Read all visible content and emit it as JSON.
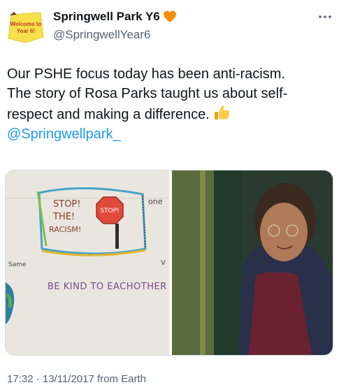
{
  "tweet": {
    "avatar_text": "Welcome to Year 6!",
    "display_name": "Springwell Park Y6",
    "handle": "@SpringwellYear6",
    "text_lines": [
      "Our PSHE focus today has been anti-racism.",
      "The story of Rosa Parks taught us about self-",
      "respect and making a difference."
    ],
    "mention": "@Springwellpark_",
    "timestamp": "17:32 · 13/11/2017 from Earth"
  },
  "media": {
    "drawing": {
      "caption_line1": "STOP!",
      "caption_line2": "THE!",
      "caption_line3": "RACISM!",
      "sign_text": "STOP!",
      "corner_right": "one",
      "left_label": "Same",
      "right_label": "V",
      "bottom_text": "BE KIND TO EACHOTHER"
    }
  },
  "colors": {
    "accent": "#1d9bf0",
    "heart": "#f4900c",
    "text_secondary": "#536471"
  }
}
